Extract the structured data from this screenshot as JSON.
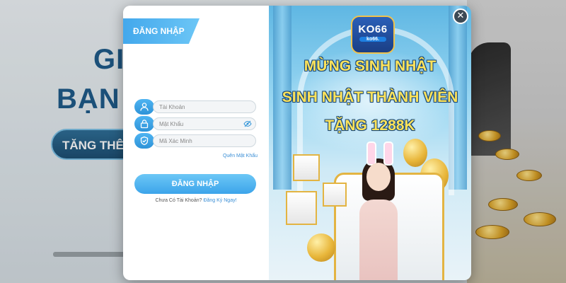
{
  "background": {
    "heading_line1": "GI",
    "heading_line2": "BẠN",
    "button_label": "TĂNG THÊM"
  },
  "login": {
    "title": "ĐĂNG NHẬP",
    "username_placeholder": "Tài Khoản",
    "password_placeholder": "Mật Khẩu",
    "captcha_placeholder": "Mã Xác Minh",
    "forgot_password": "Quên Mật Khẩu",
    "submit_label": "ĐĂNG NHẬP",
    "no_account_text": "Chưa Có Tài Khoản?",
    "register_link": "Đăng Ký Ngay!"
  },
  "promo": {
    "logo_main": "KO66",
    "logo_sub": "ko66.",
    "line1": "MỪNG SINH NHẬT",
    "line2": "SINH NHẬT THÀNH VIÊN",
    "line3": "TẶNG 1288K"
  },
  "icons": {
    "user": "user-icon",
    "password": "lock-icon",
    "captcha": "shield-check-icon",
    "eye": "eye-slash-icon",
    "close": "close-icon"
  },
  "colors": {
    "accent": "#3ca4ea",
    "promo_text": "#ffe35a",
    "link": "#3b8fd6"
  }
}
